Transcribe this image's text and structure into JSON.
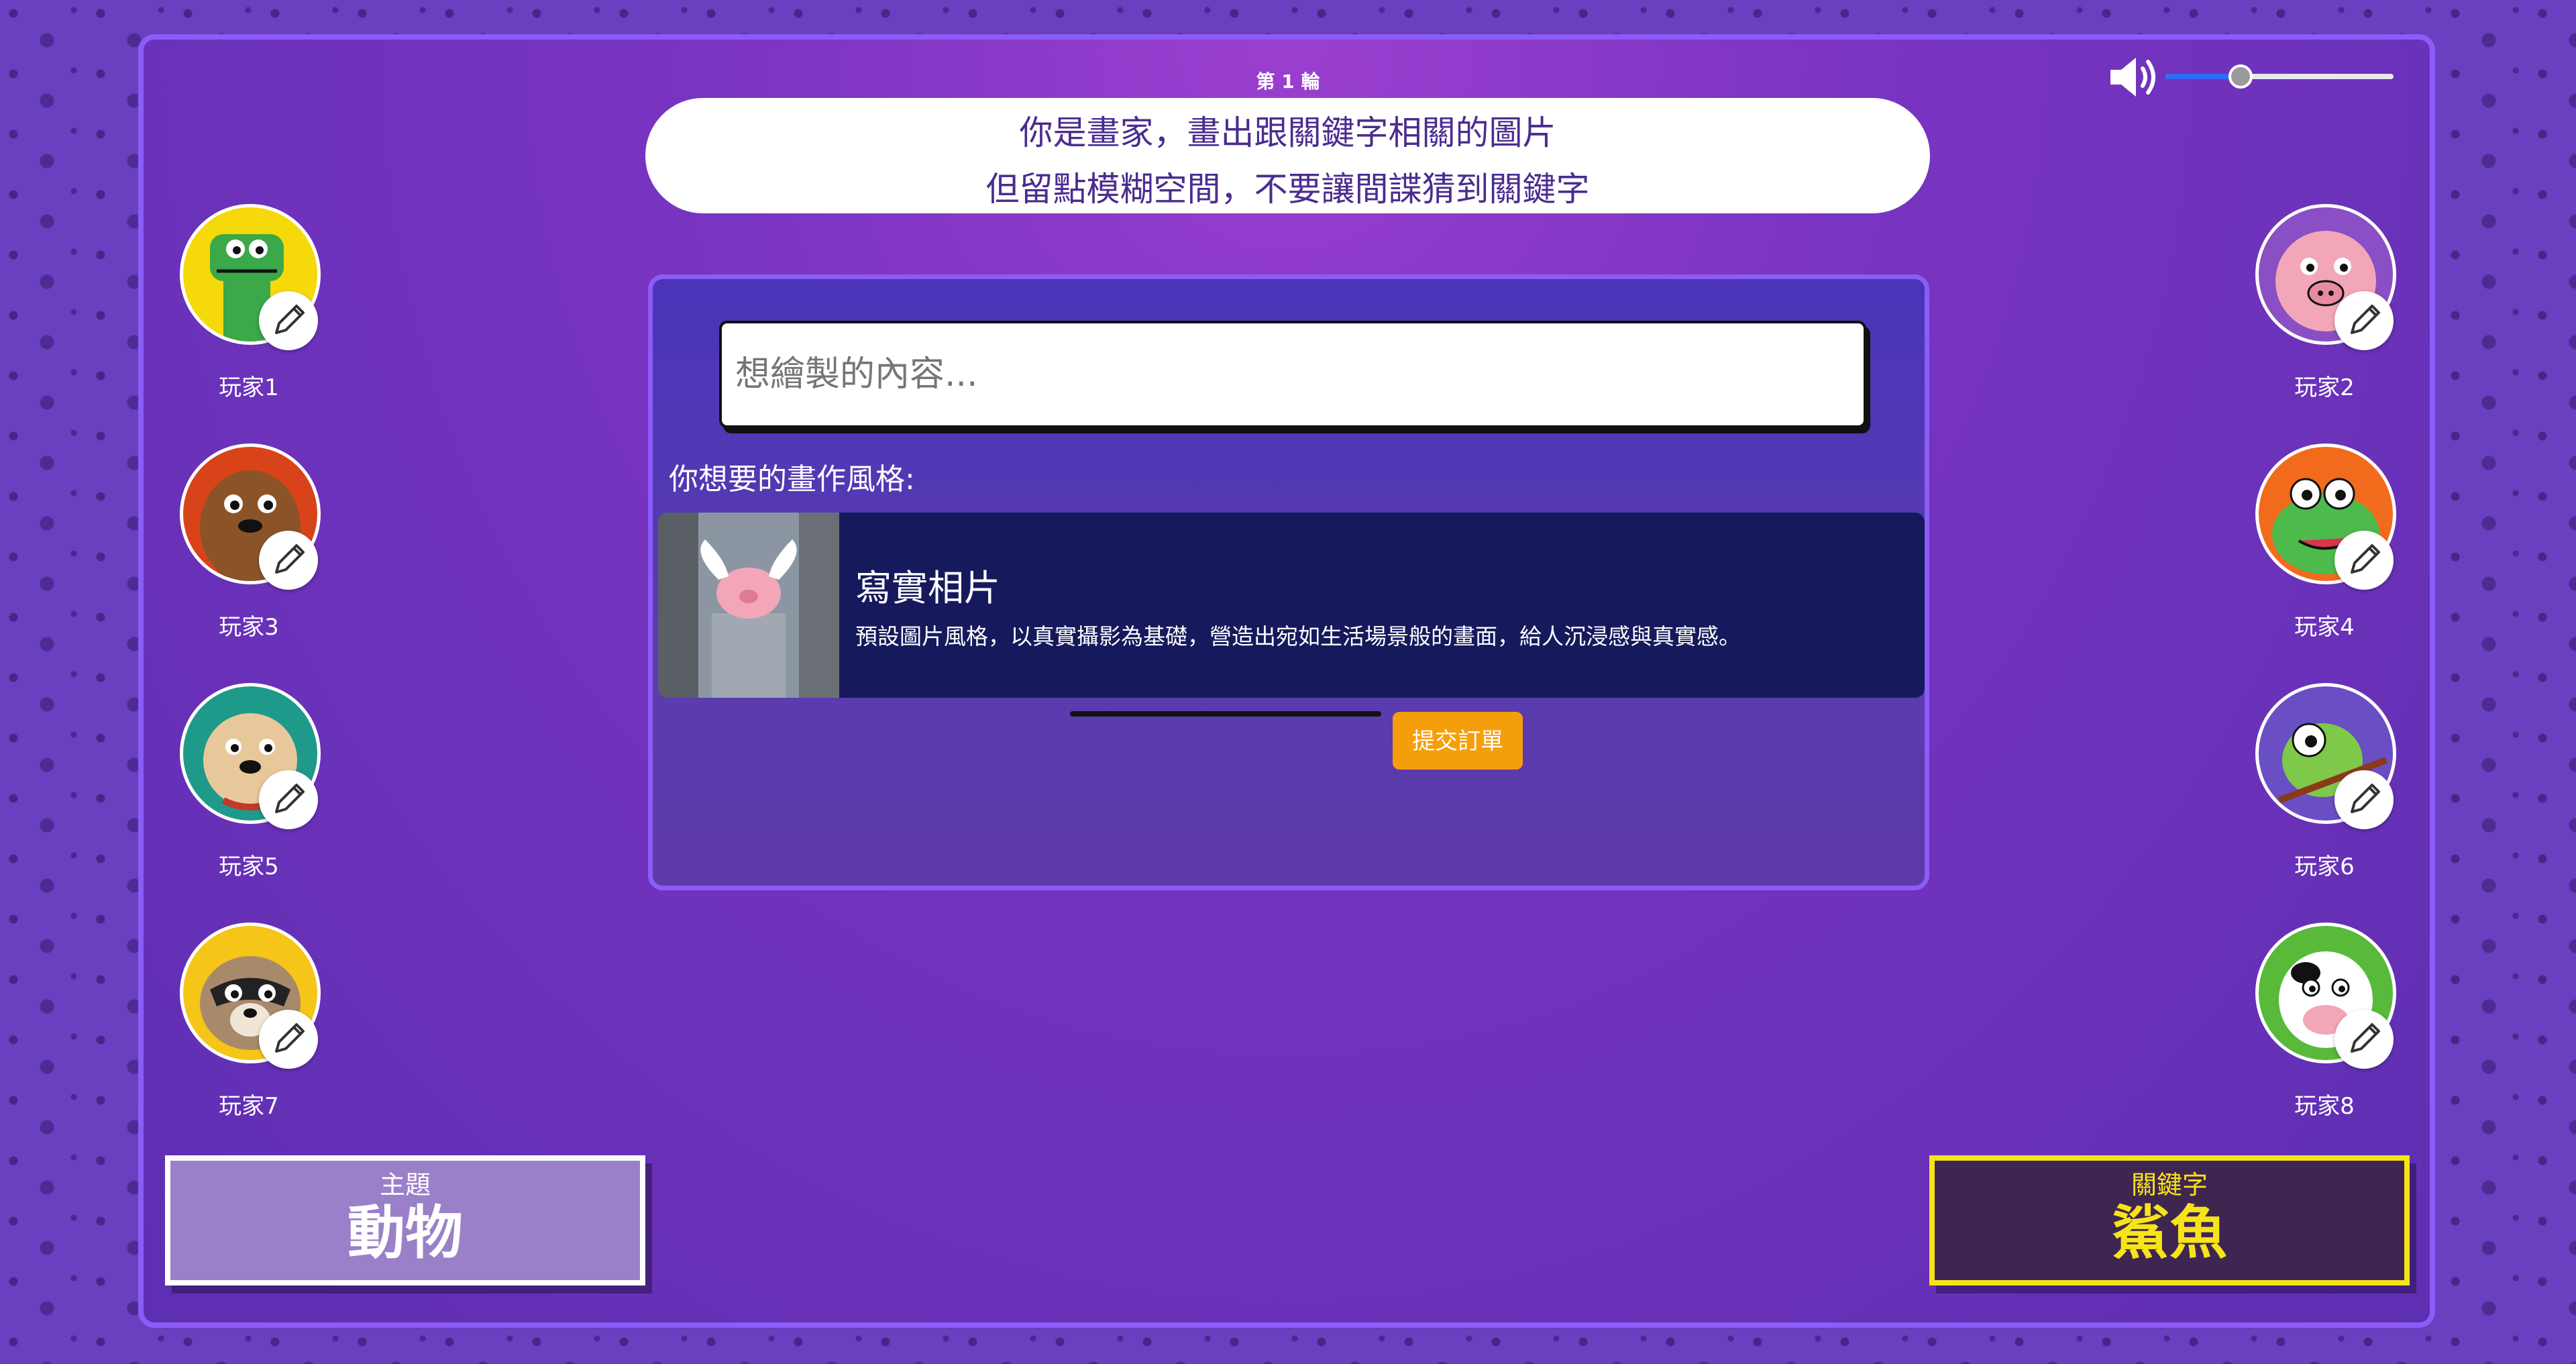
{
  "round": {
    "label": "第 1 輪"
  },
  "instruction": {
    "line1": "你是畫家，畫出跟關鍵字相關的圖片",
    "line2": "但留點模糊空間，不要讓間諜猜到關鍵字"
  },
  "volume": {
    "level": 0.33,
    "icon": "speaker-icon"
  },
  "players": [
    {
      "name": "玩家1",
      "animal": "dinosaur",
      "bg": "#f5d90a"
    },
    {
      "name": "玩家2",
      "animal": "pig",
      "bg": "#8a4fc4"
    },
    {
      "name": "玩家3",
      "animal": "otter",
      "bg": "#d8431a"
    },
    {
      "name": "玩家4",
      "animal": "crocodile",
      "bg": "#f26b1d"
    },
    {
      "name": "玩家5",
      "animal": "bulldog",
      "bg": "#1f9a8a"
    },
    {
      "name": "玩家6",
      "animal": "chameleon",
      "bg": "#6a4fc4"
    },
    {
      "name": "玩家7",
      "animal": "raccoon",
      "bg": "#f5c518"
    },
    {
      "name": "玩家8",
      "animal": "cow",
      "bg": "#58b93a"
    }
  ],
  "drawing_panel": {
    "prompt_placeholder": "想繪製的內容...",
    "style_label": "你想要的畫作風格:",
    "style": {
      "name": "寫實相片",
      "description": "預設圖片風格，以真實攝影為基礎，營造出宛如生活場景般的畫面，給人沉浸感與真實感。",
      "thumbnail": "flying-pig-photo"
    },
    "submit_label": "提交訂單"
  },
  "topic": {
    "label": "主題",
    "value": "動物"
  },
  "keyword": {
    "label": "關鍵字",
    "value": "鯊魚"
  },
  "colors": {
    "accent": "#8b5cf6",
    "keyword": "#f7e418",
    "submit": "#f59e0b"
  }
}
